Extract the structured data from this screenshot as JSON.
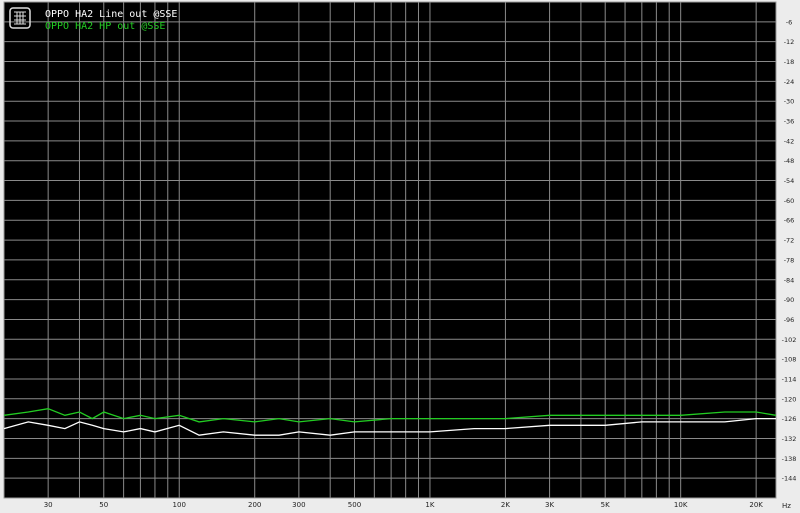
{
  "chart_data": {
    "type": "line",
    "title": "",
    "xlabel": "",
    "ylabel": "",
    "x_scale": "log",
    "xlim": [
      20,
      24000
    ],
    "ylim": [
      -150,
      0
    ],
    "x_unit": "Hz",
    "x_tick_labels": [
      {
        "value": 30,
        "label": "30"
      },
      {
        "value": 50,
        "label": "50"
      },
      {
        "value": 100,
        "label": "100"
      },
      {
        "value": 200,
        "label": "200"
      },
      {
        "value": 300,
        "label": "300"
      },
      {
        "value": 500,
        "label": "500"
      },
      {
        "value": 1000,
        "label": "1K"
      },
      {
        "value": 2000,
        "label": "2K"
      },
      {
        "value": 3000,
        "label": "3K"
      },
      {
        "value": 5000,
        "label": "5K"
      },
      {
        "value": 10000,
        "label": "10K"
      },
      {
        "value": 20000,
        "label": "20K"
      }
    ],
    "y_ticks": [
      -6,
      -12,
      -18,
      -24,
      -30,
      -36,
      -42,
      -48,
      -54,
      -60,
      -66,
      -72,
      -78,
      -84,
      -90,
      -96,
      -102,
      -108,
      -114,
      -120,
      -126,
      -132,
      -138,
      -144
    ],
    "grid": true,
    "legend_position": "top-left",
    "series": [
      {
        "name": "OPPO HA2 Line out @SSE",
        "color": "#ffffff",
        "x": [
          20,
          25,
          30,
          35,
          40,
          45,
          50,
          60,
          70,
          80,
          100,
          120,
          150,
          200,
          250,
          300,
          400,
          500,
          700,
          1000,
          1500,
          2000,
          3000,
          5000,
          7000,
          10000,
          15000,
          20000,
          24000
        ],
        "y": [
          -129,
          -127,
          -128,
          -129,
          -127,
          -128,
          -129,
          -130,
          -129,
          -130,
          -128,
          -131,
          -130,
          -131,
          -131,
          -130,
          -131,
          -130,
          -130,
          -130,
          -129,
          -129,
          -128,
          -128,
          -127,
          -127,
          -127,
          -126,
          -126
        ]
      },
      {
        "name": "OPPO HA2 HP out @SSE",
        "color": "#22cc22",
        "x": [
          20,
          25,
          30,
          35,
          40,
          45,
          50,
          60,
          70,
          80,
          100,
          120,
          150,
          200,
          250,
          300,
          400,
          500,
          700,
          1000,
          1500,
          2000,
          3000,
          5000,
          7000,
          10000,
          15000,
          20000,
          24000
        ],
        "y": [
          -125,
          -124,
          -123,
          -125,
          -124,
          -126,
          -124,
          -126,
          -125,
          -126,
          -125,
          -127,
          -126,
          -127,
          -126,
          -127,
          -126,
          -127,
          -126,
          -126,
          -126,
          -126,
          -125,
          -125,
          -125,
          -125,
          -124,
          -124,
          -125
        ]
      }
    ]
  }
}
